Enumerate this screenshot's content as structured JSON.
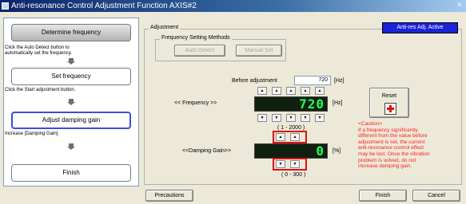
{
  "window": {
    "title": "Anti-resonance Control Adjustment Function AXIS#2",
    "close_glyph": "×"
  },
  "steps": {
    "determine_frequency": "Determine frequency",
    "hint_1a": "Click the Auto Detect button to",
    "hint_1b": "automatically set the frequency.",
    "set_frequency": "Set frequency",
    "hint_2": "Click the Start adjustment button.",
    "adjust_damping_gain": "Adjust damping gain",
    "hint_3": "Increase [Damping Gain].",
    "finish": "Finish"
  },
  "adjustment": {
    "group_label": "Adjustment",
    "badge": "Anti-res Adj. Active",
    "methods_label": "Frequency Setting Methods",
    "auto_detect": "Auto Detect",
    "manual_set": "Manual Set",
    "before_label": "Before adjustment",
    "before_value": "720",
    "hz_bracket": "[Hz]",
    "frequency_label": "<< Frequency >>",
    "frequency_display": "720",
    "frequency_range": "( 1 - 2000 )",
    "damping_label": "<<Damping Gain>>",
    "damping_display": "0",
    "pct_bracket": "[%]",
    "damping_range": "( 0 - 300 )",
    "reset_label": "Reset",
    "up_glyph": "▲",
    "down_glyph": "▼"
  },
  "caution": {
    "title": "<Caution>",
    "lines": [
      "If a frequency significantly",
      "different from the value before",
      "adjustment is set, the current",
      "anti-resonance control effect",
      "may be lost. Once the vibration",
      "problem is solved, do not",
      "increase damping gain."
    ]
  },
  "footer": {
    "precautions": "Precautions",
    "finish": "Finish",
    "cancel": "Cancel"
  },
  "colors": {
    "badge": "#1a23d8",
    "lcd_on": "#22ff55",
    "highlight": "#e01010",
    "caution_text": "#ff2020"
  }
}
